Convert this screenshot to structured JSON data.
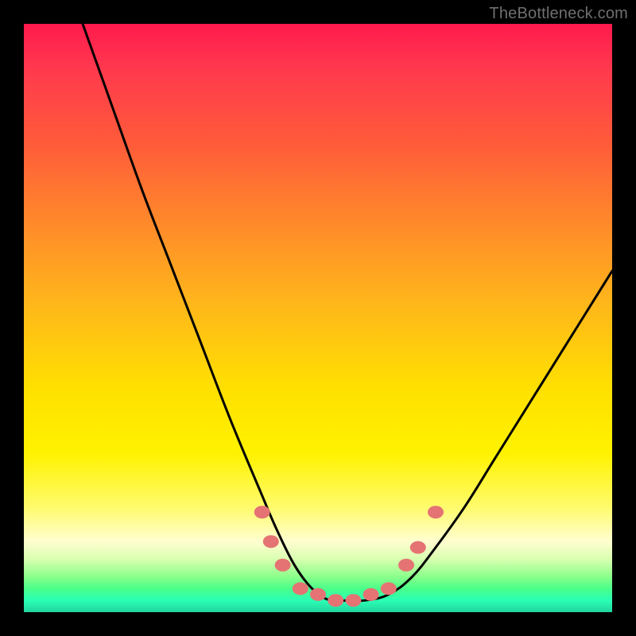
{
  "watermark": "TheBottleneck.com",
  "colors": {
    "gradient_top": "#ff1a4d",
    "gradient_mid": "#ffe000",
    "gradient_bottom": "#22d49e",
    "curve": "#000000",
    "beads": "#e57373",
    "frame": "#000000"
  },
  "chart_data": {
    "type": "line",
    "title": "",
    "xlabel": "",
    "ylabel": "",
    "xlim": [
      0,
      100
    ],
    "ylim": [
      0,
      100
    ],
    "grid": false,
    "legend": false,
    "series": [
      {
        "name": "bottleneck-curve",
        "x": [
          10,
          15,
          20,
          25,
          30,
          35,
          40,
          43,
          46,
          49,
          52,
          55,
          58,
          62,
          66,
          70,
          75,
          80,
          85,
          90,
          95,
          100
        ],
        "y": [
          100,
          86,
          72,
          59,
          46,
          33,
          21,
          14,
          8,
          4,
          2,
          2,
          2,
          3,
          6,
          11,
          18,
          26,
          34,
          42,
          50,
          58
        ]
      }
    ],
    "markers": [
      {
        "name": "bead-left-1",
        "x": 40.5,
        "y": 17
      },
      {
        "name": "bead-left-2",
        "x": 42,
        "y": 12
      },
      {
        "name": "bead-left-3",
        "x": 44,
        "y": 8
      },
      {
        "name": "bead-bottom-1",
        "x": 47,
        "y": 4
      },
      {
        "name": "bead-bottom-2",
        "x": 50,
        "y": 3
      },
      {
        "name": "bead-bottom-3",
        "x": 53,
        "y": 2
      },
      {
        "name": "bead-bottom-4",
        "x": 56,
        "y": 2
      },
      {
        "name": "bead-bottom-5",
        "x": 59,
        "y": 3
      },
      {
        "name": "bead-bottom-6",
        "x": 62,
        "y": 4
      },
      {
        "name": "bead-right-1",
        "x": 65,
        "y": 8
      },
      {
        "name": "bead-right-2",
        "x": 67,
        "y": 11
      },
      {
        "name": "bead-right-3",
        "x": 70,
        "y": 17
      }
    ]
  }
}
